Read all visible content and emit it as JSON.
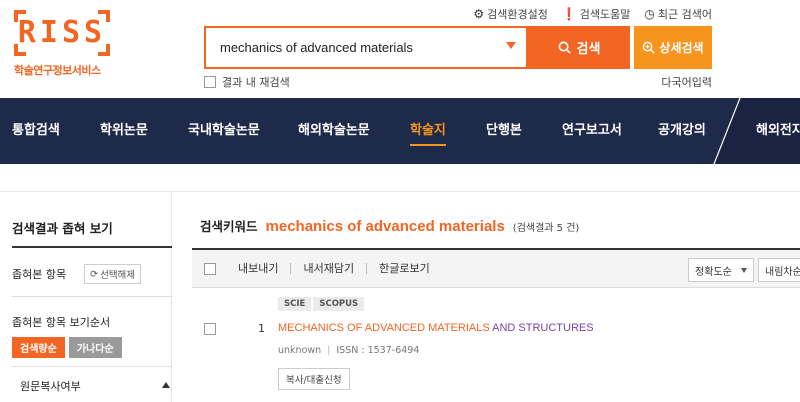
{
  "logo": {
    "text": "RISS",
    "subtitle": "학술연구정보서비스"
  },
  "header": {
    "top_links": [
      {
        "label": "검색환경설정",
        "icon": "gear-icon"
      },
      {
        "label": "검색도움말",
        "icon": "help-icon"
      },
      {
        "label": "최근 검색어",
        "icon": "clock-icon"
      }
    ],
    "search_value": "mechanics of advanced materials",
    "search_button": "검색",
    "advanced_button": "상세검색",
    "research_within": "결과 내 재검색",
    "multi_lang": "다국어입력"
  },
  "nav": {
    "items": [
      {
        "label": "통합검색",
        "active": false
      },
      {
        "label": "학위논문",
        "active": false
      },
      {
        "label": "국내학술논문",
        "active": false
      },
      {
        "label": "해외학술논문",
        "active": false
      },
      {
        "label": "학술지",
        "active": true
      },
      {
        "label": "단행본",
        "active": false
      },
      {
        "label": "연구보고서",
        "active": false
      },
      {
        "label": "공개강의",
        "active": false
      },
      {
        "label": "해외전자",
        "active": false
      }
    ]
  },
  "sidebar": {
    "title": "검색결과 좁혀 보기",
    "narrowed_label": "좁혀본 항목",
    "reset_label": "선택해제",
    "sort_title": "좁혀본 항목 보기순서",
    "sort_options": [
      "검색량순",
      "가나다순"
    ],
    "copy_title": "원문복사여부"
  },
  "main": {
    "keyword_label": "검색키워드",
    "keyword_value": "mechanics of advanced materials",
    "result_count": "(검색결과 5 건)",
    "toolbar": [
      "내보내기",
      "내서재담기",
      "한글로보기"
    ],
    "sort_select": "정확도순",
    "order_select": "내림차순"
  },
  "results": [
    {
      "number": "1",
      "badges": [
        "SCIE",
        "SCOPUS"
      ],
      "title_highlight": "MECHANICS OF ADVANCED MATERIALS",
      "title_rest": " AND STRUCTURES",
      "author": "unknown",
      "issn": "ISSN : 1537-6494",
      "action": "복사/대출신청"
    }
  ],
  "colors": {
    "accent": "#f26522",
    "accent_light": "#f7941d",
    "nav_bg": "#1e2a4a",
    "title_purple": "#7b3fa8"
  }
}
